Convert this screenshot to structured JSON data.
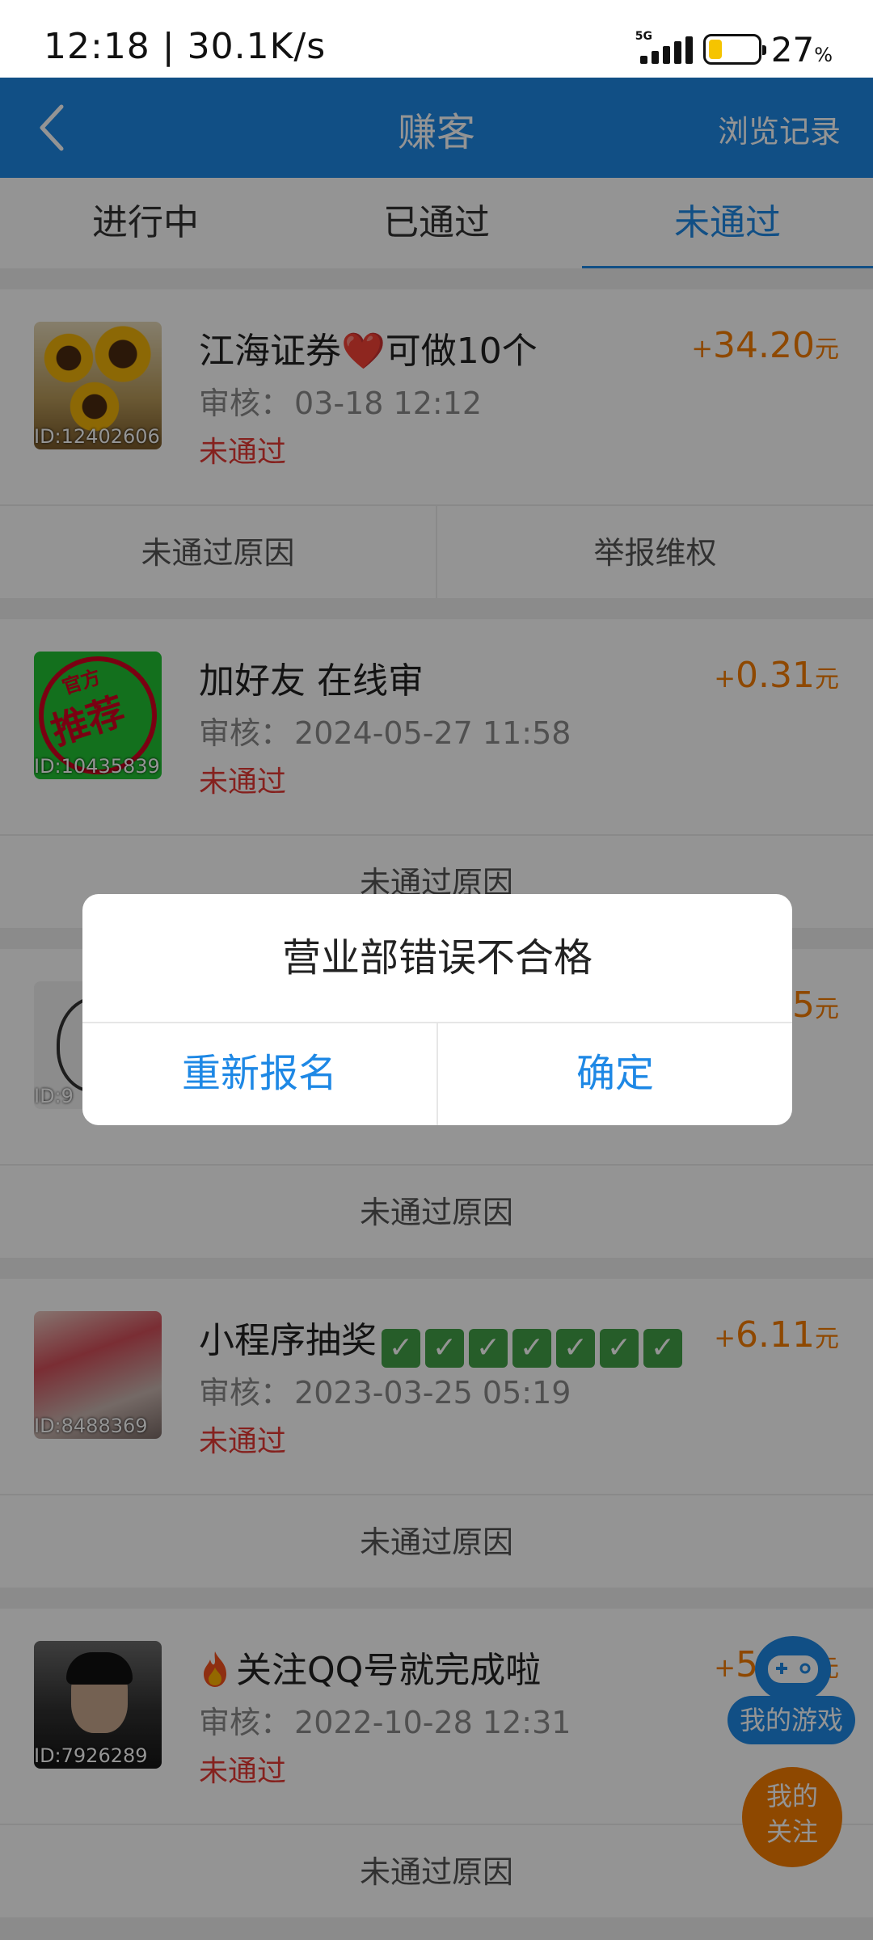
{
  "status_bar": {
    "time": "12:18",
    "speed": "30.1K/s",
    "network": "5G",
    "battery_percent": "27",
    "battery_unit": "%",
    "battery_level": 0.27
  },
  "app_bar": {
    "title": "赚客",
    "right_action": "浏览记录"
  },
  "tabs": [
    {
      "label": "进行中",
      "active": false
    },
    {
      "label": "已通过",
      "active": false
    },
    {
      "label": "未通过",
      "active": true
    }
  ],
  "items": [
    {
      "id": "ID:12402606",
      "title": "江海证券❤️可做10个",
      "audit_label": "审核：",
      "audit_time": "03-18 12:12",
      "state": "未通过",
      "amount_plus": "+",
      "amount": "34.20",
      "amount_unit": "元",
      "actions": [
        "未通过原因",
        "举报维权"
      ]
    },
    {
      "id": "ID:10435839",
      "title": "加好友 在线审",
      "audit_label": "审核：",
      "audit_time": "2024-05-27 11:58",
      "state": "未通过",
      "amount_plus": "+",
      "amount": "0.31",
      "amount_unit": "元",
      "actions": [
        "未通过原因"
      ],
      "thumb_text_top": "官方",
      "thumb_text_main": "推荐"
    },
    {
      "id": "ID:9",
      "title": "",
      "audit_label": "",
      "audit_time": "",
      "state": "",
      "amount_plus": "",
      "amount": "5",
      "amount_unit": "元",
      "actions": [
        "未通过原因"
      ]
    },
    {
      "id": "ID:8488369",
      "title": "小程序抽奖",
      "title_suffix": "✓✓✓✓✓✓✓",
      "audit_label": "审核：",
      "audit_time": "2023-03-25 05:19",
      "state": "未通过",
      "amount_plus": "+",
      "amount": "6.11",
      "amount_unit": "元",
      "actions": [
        "未通过原因"
      ]
    },
    {
      "id": "ID:7926289",
      "title": "关注QQ号就完成啦",
      "audit_label": "审核：",
      "audit_time": "2022-10-28 12:31",
      "state": "未通过",
      "amount_plus": "+",
      "amount": "5.41",
      "amount_unit": "元",
      "actions": [
        "未通过原因"
      ]
    }
  ],
  "dialog": {
    "message": "营业部错误不合格",
    "left_button": "重新报名",
    "right_button": "确定"
  },
  "floating": {
    "game_label": "我的游戏",
    "follow_label_1": "我的",
    "follow_label_2": "关注"
  },
  "colors": {
    "primary": "#1e88e5",
    "amount": "#f57c00",
    "failed": "#e53935",
    "overlay": "rgba(0,0,0,0.42)"
  }
}
